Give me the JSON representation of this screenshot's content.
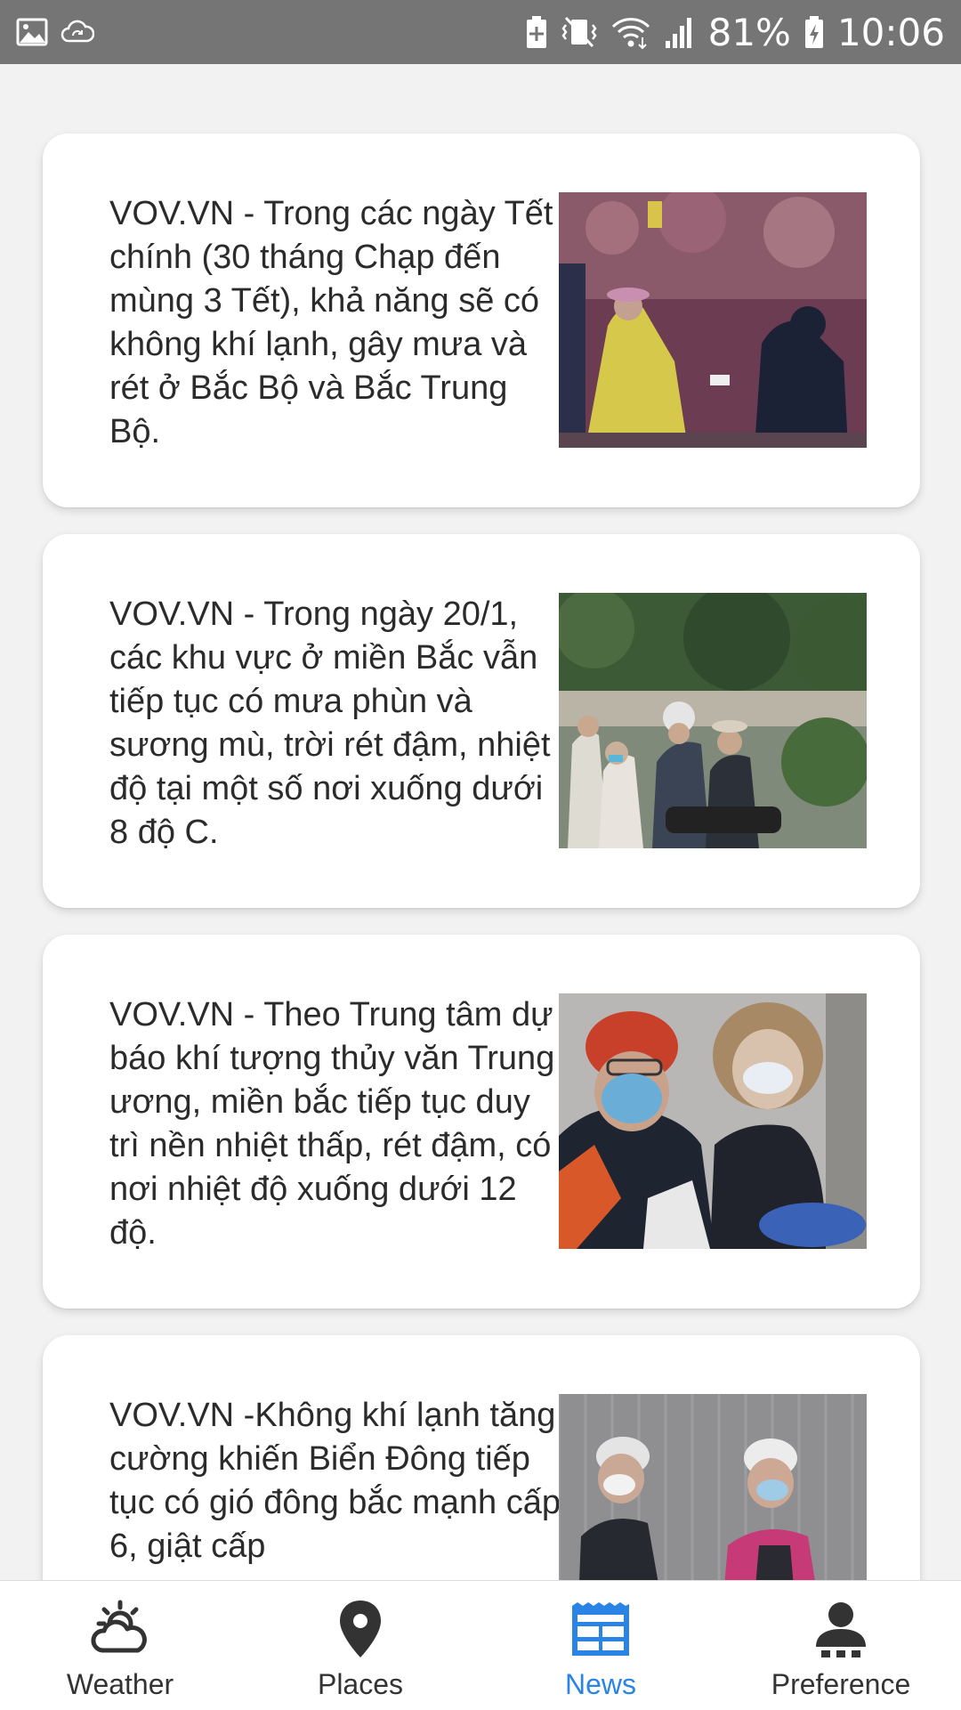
{
  "status_bar": {
    "battery_percent": "81%",
    "time": "10:06",
    "icons": [
      "image-icon",
      "cloud-sync-icon",
      "battery-saver-icon",
      "vibrate-icon",
      "wifi-icon",
      "signal-icon",
      "battery-charging-icon"
    ]
  },
  "news": {
    "items": [
      {
        "text": "VOV.VN - Trong các ngày Tết chính (30 tháng Chạp đến mùng 3 Tết), khả năng sẽ có không khí lạnh, gây mưa và rét ở Bắc Bộ và Bắc Trung Bộ."
      },
      {
        "text": "VOV.VN - Trong ngày 20/1, các khu vực ở miền Bắc vẫn tiếp tục có mưa phùn và sương mù, trời rét đậm, nhiệt độ tại một số nơi xuống dưới 8 độ C."
      },
      {
        "text": "VOV.VN - Theo Trung tâm dự báo khí tượng thủy văn Trung ương, miền bắc tiếp tục duy trì nền nhiệt thấp, rét đậm, có nơi nhiệt độ xuống dưới 12 độ."
      },
      {
        "text": "VOV.VN -Không khí lạnh tăng cường khiến Biển Đông tiếp tục có gió đông bắc mạnh cấp 6, giật cấp"
      }
    ]
  },
  "bottom_nav": {
    "items": [
      {
        "label": "Weather",
        "icon": "weather-icon"
      },
      {
        "label": "Places",
        "icon": "location-pin-icon"
      },
      {
        "label": "News",
        "icon": "news-icon",
        "active": true
      },
      {
        "label": "Preference",
        "icon": "person-icon"
      }
    ],
    "active_color": "#2a84e6",
    "inactive_color": "#333333"
  }
}
